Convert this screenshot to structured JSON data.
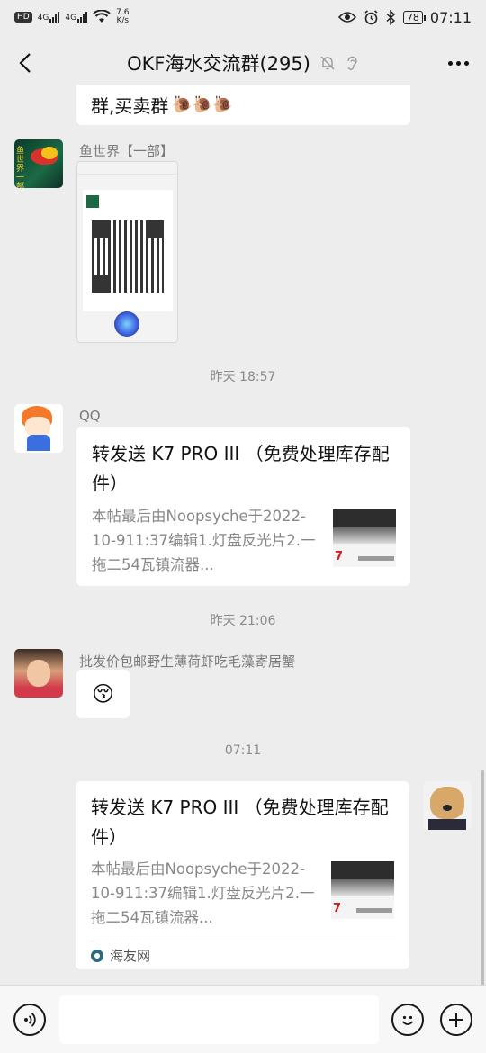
{
  "status_bar": {
    "hd_badge": "HD",
    "network_1": "4G",
    "network_2": "4G",
    "speed_value": "7.6",
    "speed_unit": "K/s",
    "battery": "78",
    "time": "07:11"
  },
  "nav": {
    "title": "OKF海水交流群(295)",
    "icons": [
      "back-icon",
      "mute-bell-icon",
      "ear-icon",
      "more-icon"
    ]
  },
  "messages": {
    "partial": {
      "text": "群,买卖群"
    },
    "qr_message": {
      "sender": "鱼世界【一部】",
      "avatar_text": "鱼世界一部"
    },
    "time1": "昨天 18:57",
    "link1": {
      "sender": "QQ",
      "title": "转发送 K7 PRO III （免费处理库存配件）",
      "desc": "本帖最后由Noopsyche于2022-10-911:37编辑1.灯盘反光片2.一拖二54瓦镇流器...",
      "thumb_text": "7"
    },
    "time2": "昨天 21:06",
    "emoji_message": {
      "sender": "批发价包邮野生薄荷虾吃毛藻寄居蟹",
      "emoji": "😚"
    },
    "time3": "07:11",
    "link2": {
      "title": "转发送 K7 PRO III （免费处理库存配件）",
      "desc": "本帖最后由Noopsyche于2022-10-911:37编辑1.灯盘反光片2.一拖二54瓦镇流器...",
      "thumb_text": "7",
      "source": "海友网"
    }
  },
  "colors": {
    "background": "#ededed",
    "bubble": "#ffffff",
    "meta_text": "#8a8a8a"
  }
}
